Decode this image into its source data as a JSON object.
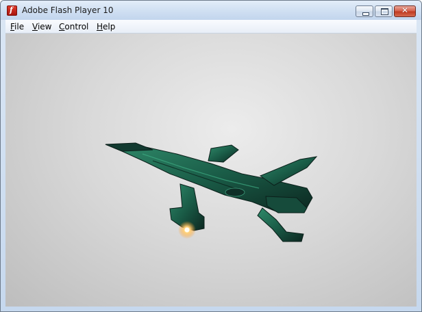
{
  "window": {
    "title": "Adobe Flash Player 10",
    "app_icon": "flash-icon",
    "controls": {
      "minimize": "minimize-icon",
      "maximize": "maximize-icon",
      "close": "close-icon"
    }
  },
  "menubar": {
    "items": [
      {
        "label": "File",
        "accel": "F",
        "rest": "ile"
      },
      {
        "label": "View",
        "accel": "V",
        "rest": "iew"
      },
      {
        "label": "Control",
        "accel": "C",
        "rest": "ontrol"
      },
      {
        "label": "Help",
        "accel": "H",
        "rest": "elp"
      }
    ]
  },
  "content": {
    "scene": "spaceship-3d-render",
    "colors": {
      "hull": "#1f6b52",
      "hull_dark": "#0e2a24",
      "glow": "#ffd27a",
      "background": "#d4d4d4"
    }
  }
}
